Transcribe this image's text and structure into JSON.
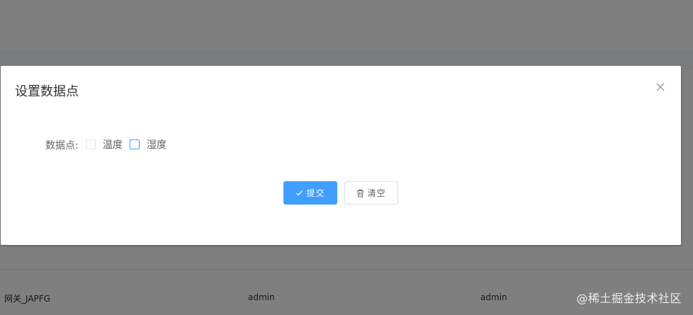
{
  "background_table": {
    "row": {
      "gateway": "网关_JAPFG",
      "creator": "admin",
      "updater": "admin"
    }
  },
  "dialog": {
    "title": "设置数据点",
    "close_icon": "close-icon",
    "form": {
      "label": "数据点:",
      "options": [
        {
          "label": "温度",
          "checked": false
        },
        {
          "label": "湿度",
          "checked": false
        }
      ]
    },
    "buttons": {
      "submit_label": "提交",
      "submit_icon": "check-icon",
      "clear_label": "清空",
      "clear_icon": "trash-icon"
    }
  },
  "watermark": "@稀土掘金技术社区",
  "colors": {
    "primary": "#409eff",
    "overlay": "rgba(0,0,0,0.5)",
    "text": "#606266"
  }
}
